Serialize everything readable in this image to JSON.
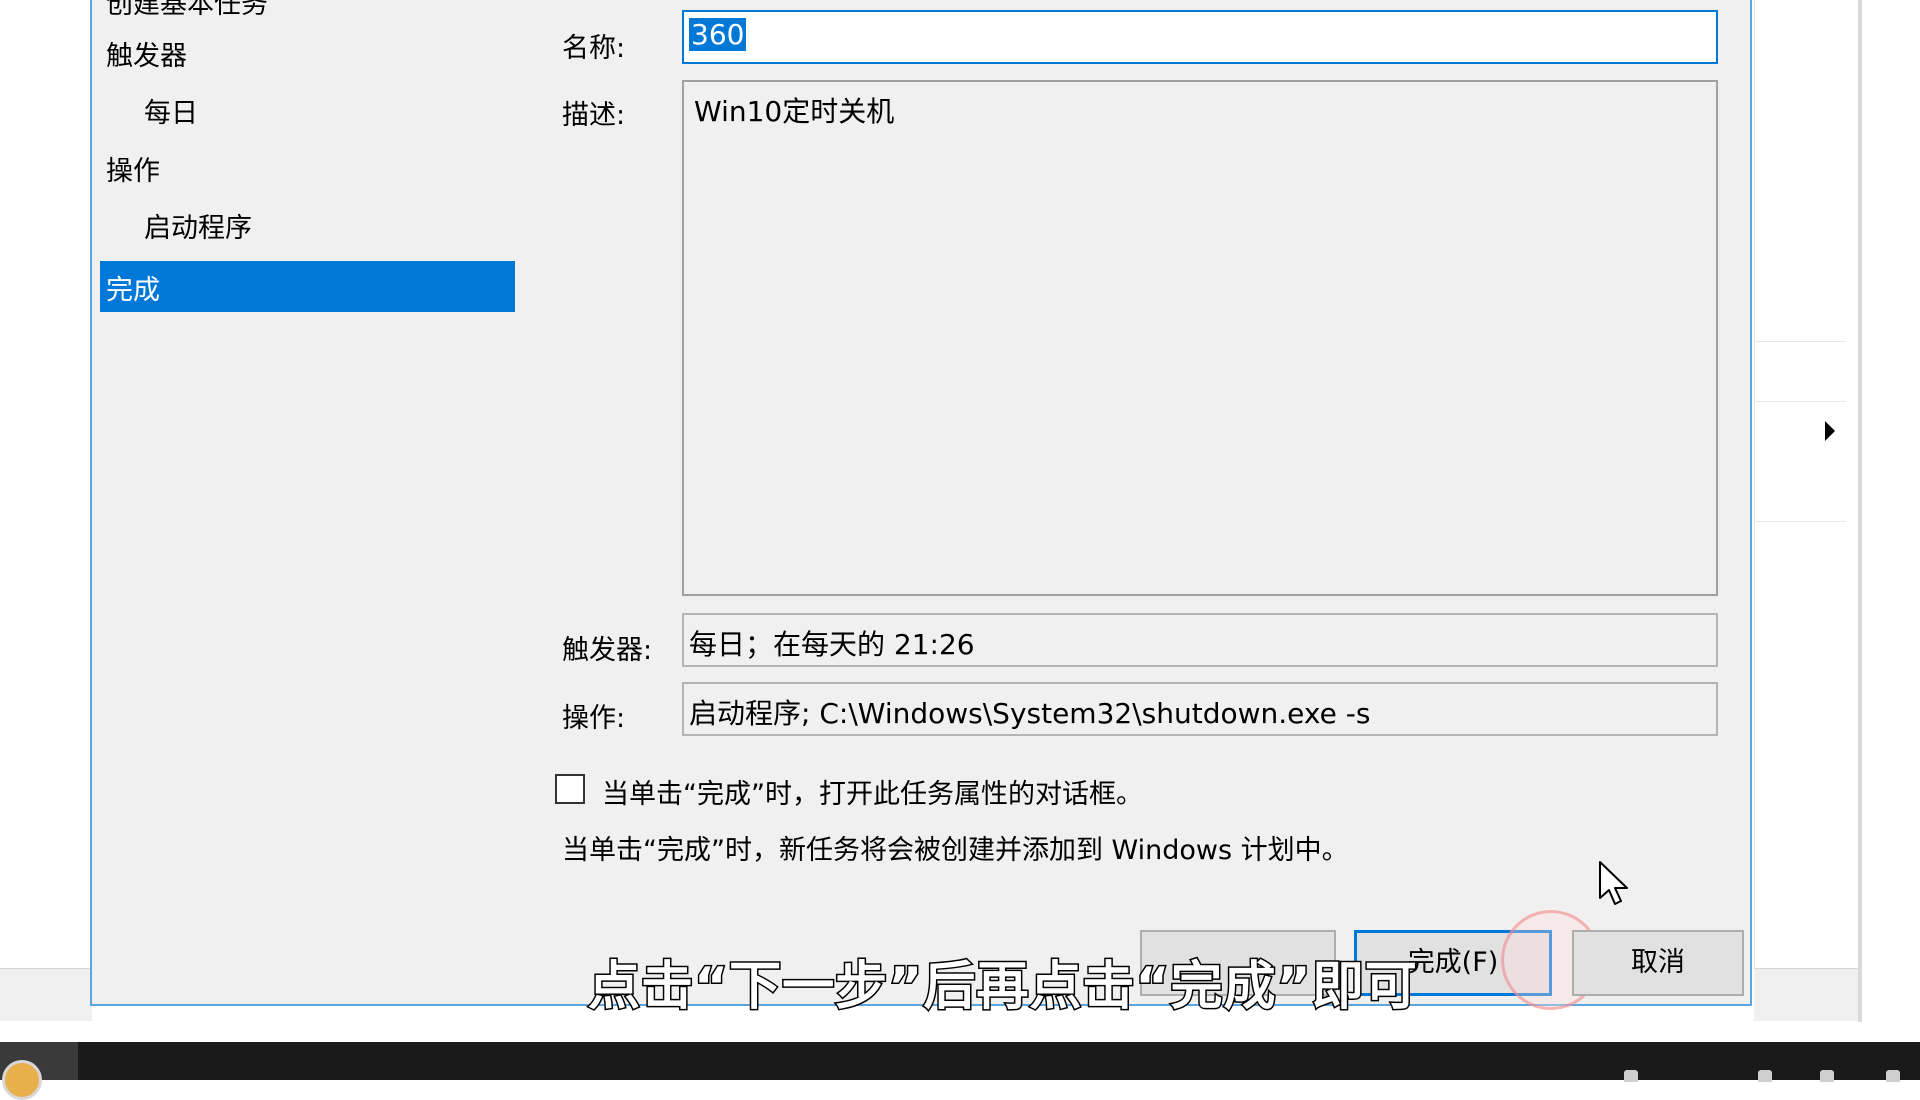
{
  "navigation": {
    "header": "创建基本任务",
    "items": [
      {
        "label": "触发器",
        "level": "top",
        "selected": false
      },
      {
        "label": "每日",
        "level": "sub",
        "selected": false
      },
      {
        "label": "操作",
        "level": "top",
        "selected": false
      },
      {
        "label": "启动程序",
        "level": "sub",
        "selected": false
      },
      {
        "label": "完成",
        "level": "top",
        "selected": true
      }
    ]
  },
  "form": {
    "name_label": "名称:",
    "name_value": "360",
    "description_label": "描述:",
    "description_value": "Win10定时关机",
    "trigger_label": "触发器:",
    "trigger_value": "每日；在每天的 21:26",
    "action_label": "操作:",
    "action_value": "启动程序; C:\\Windows\\System32\\shutdown.exe -s",
    "open_properties_checkbox_label": "当单击“完成”时，打开此任务属性的对话框。",
    "open_properties_checked": false,
    "info_text": "当单击“完成”时，新任务将会被创建并添加到 Windows 计划中。"
  },
  "buttons": {
    "back_label": "",
    "finish_label": "完成(F)",
    "cancel_label": "取消"
  },
  "subtitle": "点击“下一步”后再点击“完成”即可",
  "colors": {
    "selection": "#0078d7",
    "dialog_background": "#f0f0f0",
    "dialog_border": "#5aa6e0"
  }
}
